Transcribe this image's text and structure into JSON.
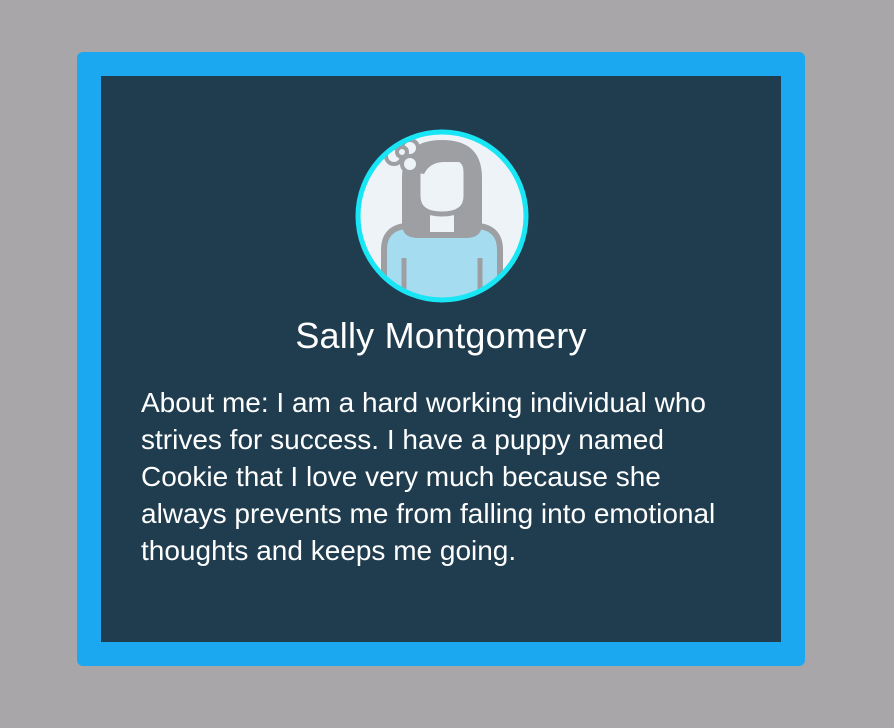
{
  "profile": {
    "name": "Sally Montgomery",
    "about": "About me: I am a hard working individual who strives for success. I have a puppy named Cookie that I love very much because she always prevents me from falling into emotional thoughts and keeps me going.",
    "avatar_icon": "female-user-avatar-icon"
  },
  "colors": {
    "page_background": "#a8a6a8",
    "frame_border": "#1ba8f0",
    "card_background": "#203d50",
    "avatar_ring": "#19e6f5",
    "avatar_background": "#eef3f7",
    "avatar_hair": "#9d9fa3",
    "avatar_shirt": "#a5dcef",
    "text": "#ffffff"
  }
}
